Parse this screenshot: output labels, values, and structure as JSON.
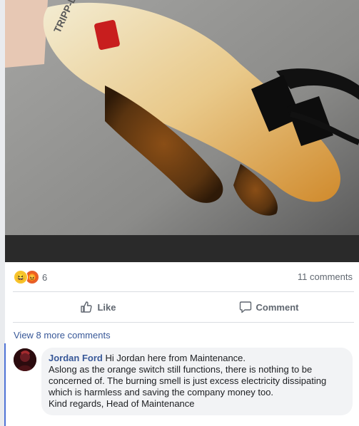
{
  "post": {
    "reactions": {
      "count": "6",
      "types": [
        "haha",
        "angry"
      ]
    },
    "comments_count": "11 comments"
  },
  "actions": {
    "like_label": "Like",
    "comment_label": "Comment"
  },
  "view_more": "View 8 more comments",
  "comment": {
    "author": "Jordan Ford",
    "first_line": "Hi Jordan here from Maintenance.",
    "body": "Aslong as the orange switch still functions, there is nothing to be concerned of. The burning smell is just excess electricity dissipating which is harmless and saving the company money too.",
    "signoff": "Kind regards, Head of Maintenance"
  },
  "photo": {
    "brand_text": "TRIPP-LITE"
  },
  "colors": {
    "link": "#385898",
    "divider": "#dadde1",
    "bubble": "#f2f3f5",
    "accent": "#4f73d6"
  }
}
